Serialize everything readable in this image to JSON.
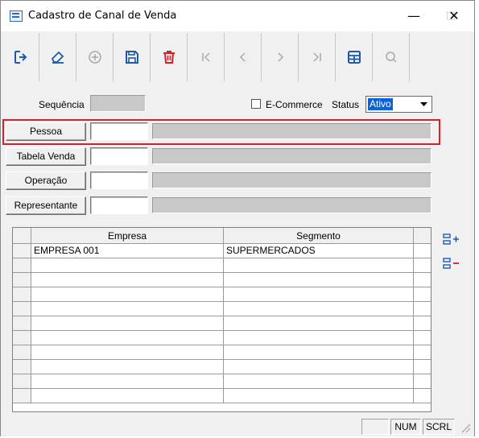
{
  "window": {
    "title": "Cadastro de Canal de Venda",
    "controls": {
      "minimize": "—",
      "maximize": "□",
      "close": "✕"
    }
  },
  "toolbar": {
    "buttons": [
      {
        "icon": "exit-icon",
        "enabled": true
      },
      {
        "icon": "eraser-icon",
        "enabled": true
      },
      {
        "icon": "add-circle-icon",
        "enabled": false
      },
      {
        "icon": "save-icon",
        "enabled": true
      },
      {
        "icon": "trash-icon",
        "enabled": true,
        "color": "#d42027"
      },
      {
        "icon": "first-record-icon",
        "enabled": false
      },
      {
        "icon": "previous-record-icon",
        "enabled": false
      },
      {
        "icon": "next-record-icon",
        "enabled": false
      },
      {
        "icon": "last-record-icon",
        "enabled": false
      },
      {
        "icon": "table-icon",
        "enabled": true
      },
      {
        "icon": "search-icon",
        "enabled": false
      }
    ]
  },
  "form": {
    "sequencia_label": "Sequência",
    "sequencia_value": "",
    "ecommerce_label": "E-Commerce",
    "ecommerce_checked": false,
    "status_label": "Status",
    "status_value": "Ativo",
    "pessoa": {
      "label": "Pessoa",
      "code": "",
      "description": ""
    },
    "tabela_venda": {
      "label": "Tabela Venda",
      "code": "",
      "description": ""
    },
    "operacao": {
      "label": "Operação",
      "code": "",
      "description": ""
    },
    "representante": {
      "label": "Representante",
      "code": "",
      "description": ""
    }
  },
  "grid": {
    "columns": [
      "Empresa",
      "Segmento"
    ],
    "rows": [
      [
        "EMPRESA 001",
        "SUPERMERCADOS"
      ],
      [
        "",
        ""
      ],
      [
        "",
        ""
      ],
      [
        "",
        ""
      ],
      [
        "",
        ""
      ],
      [
        "",
        ""
      ],
      [
        "",
        ""
      ],
      [
        "",
        ""
      ],
      [
        "",
        ""
      ],
      [
        "",
        ""
      ],
      [
        "",
        ""
      ]
    ],
    "side_buttons": [
      "add-row-icon",
      "remove-row-icon"
    ]
  },
  "statusbar": {
    "panels": [
      "",
      "NUM",
      "SCRL"
    ]
  },
  "colors": {
    "accent": "#0a64d8",
    "highlight": "#d42027",
    "icon_blue": "#1e5aa8",
    "disabled": "#a8a8a8"
  }
}
